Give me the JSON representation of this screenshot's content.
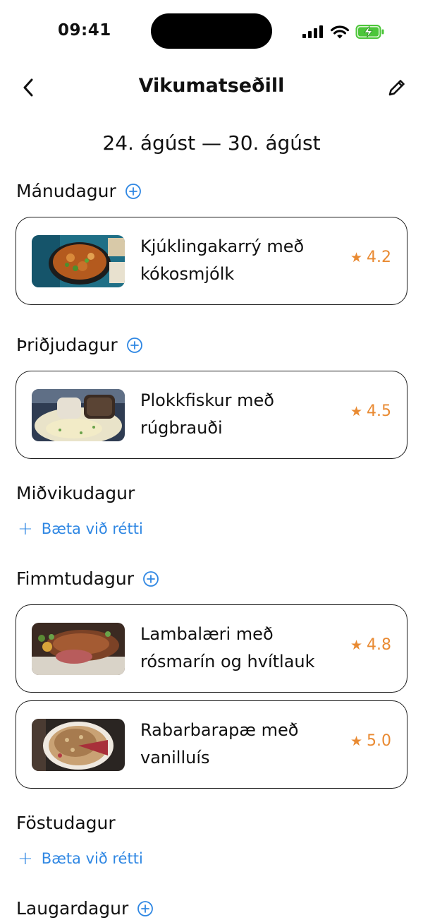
{
  "status_bar": {
    "time": "09:41"
  },
  "nav": {
    "title": "Vikumatseðill"
  },
  "date_range": "24. ágúst — 30. ágúst",
  "add_dish_label": "Bæta við rétti",
  "accent_color": "#2f87e3",
  "rating_color": "#e98a32",
  "days": [
    {
      "name": "Mánudagur",
      "dishes": [
        {
          "name": "Kjúklingakarrý með kókosmjólk",
          "rating": "4.2"
        }
      ]
    },
    {
      "name": "Þriðjudagur",
      "dishes": [
        {
          "name": "Plokkfiskur með rúgbrauði",
          "rating": "4.5"
        }
      ]
    },
    {
      "name": "Miðvikudagur",
      "dishes": []
    },
    {
      "name": "Fimmtudagur",
      "dishes": [
        {
          "name": "Lambalæri með rósmarín og hvítlauk",
          "rating": "4.8"
        },
        {
          "name": "Rabarbarapæ með vanilluís",
          "rating": "5.0"
        }
      ]
    },
    {
      "name": "Föstudagur",
      "dishes": []
    },
    {
      "name": "Laugardagur",
      "dishes": []
    }
  ]
}
